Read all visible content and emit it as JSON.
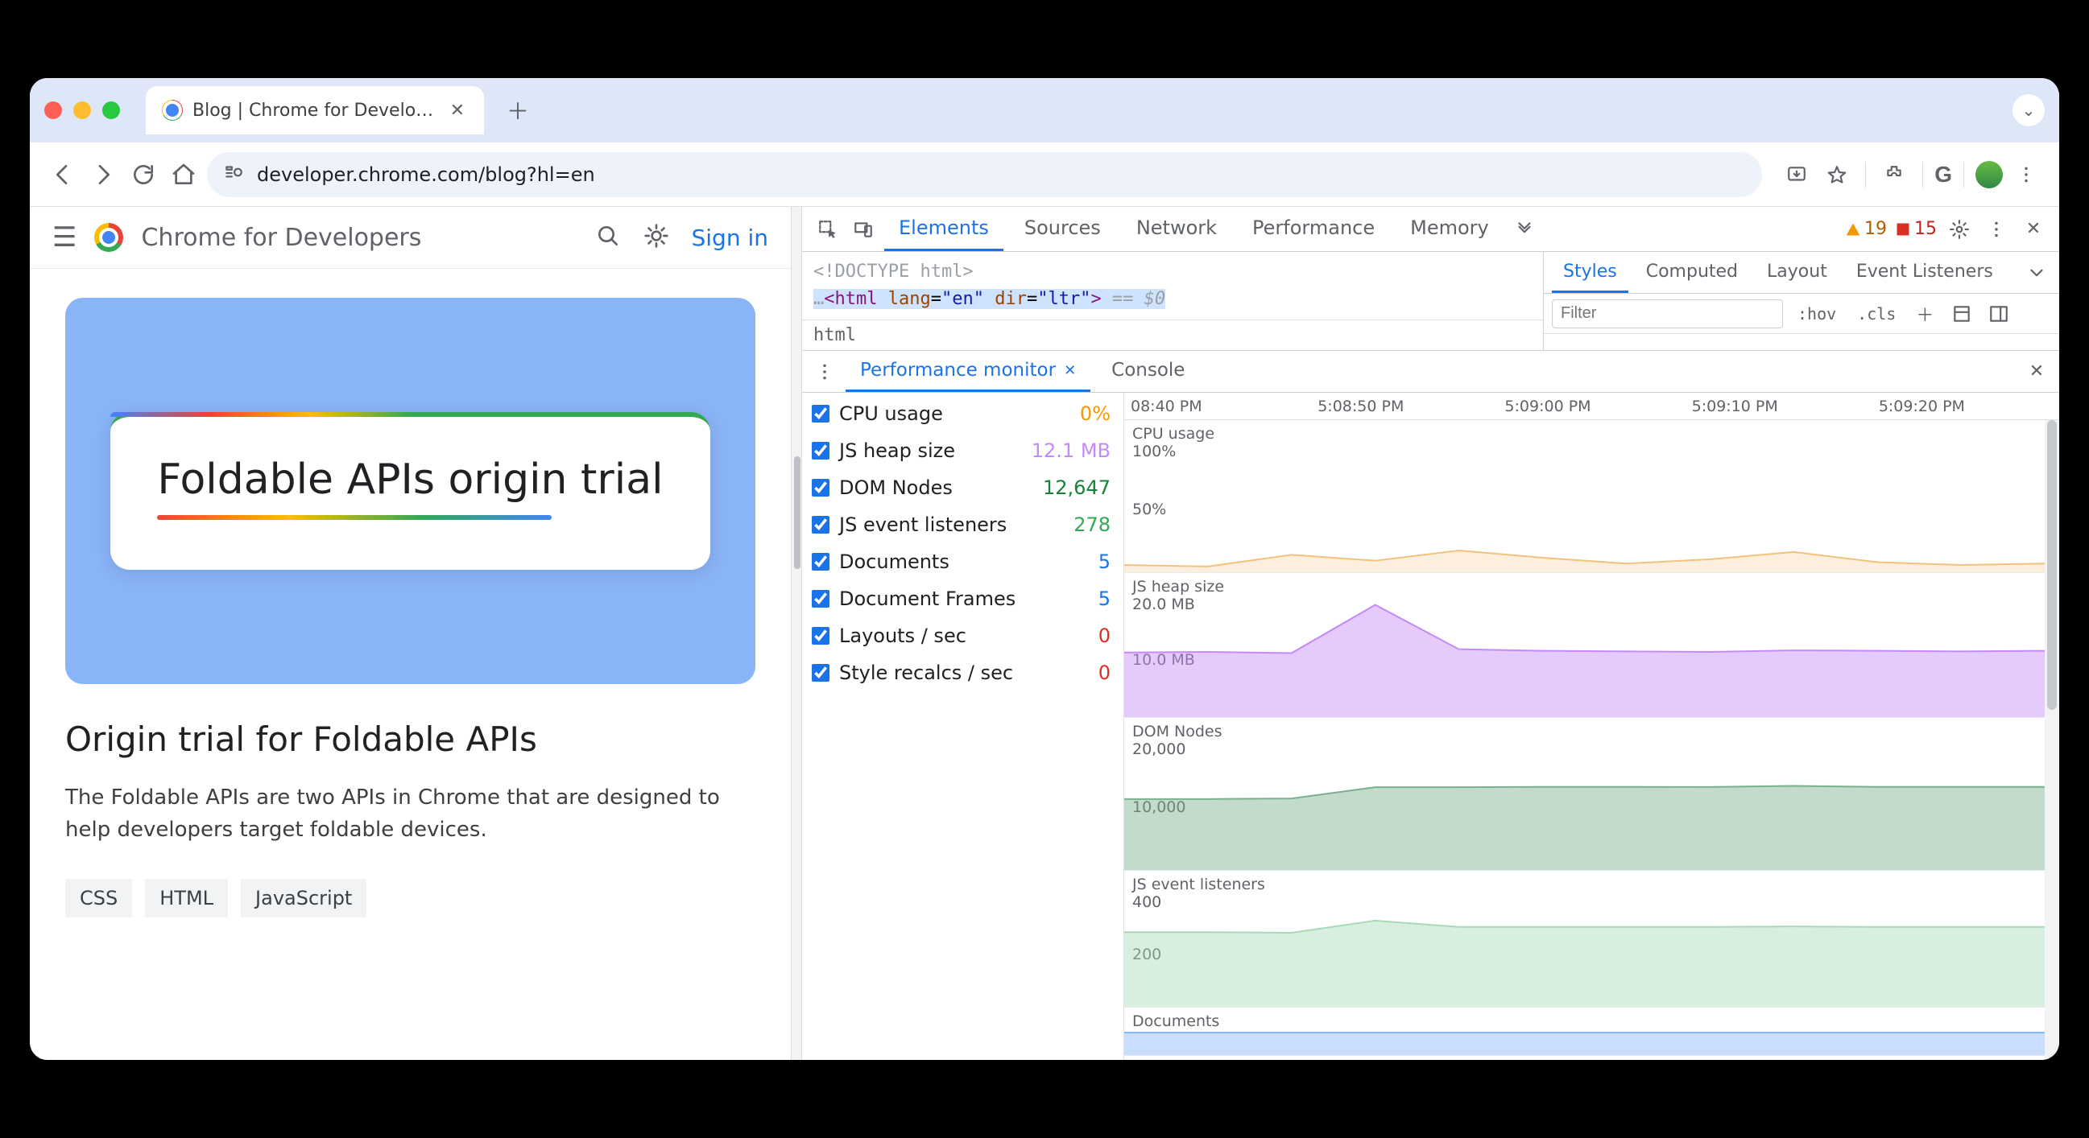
{
  "browser": {
    "tab_title": "Blog  |  Chrome for Developer",
    "url": "developer.chrome.com/blog?hl=en"
  },
  "page": {
    "site_title": "Chrome for Developers",
    "sign_in": "Sign in",
    "hero_title": "Foldable APIs origin trial",
    "article_title": "Origin trial for Foldable APIs",
    "article_body": "The Foldable APIs are two APIs in Chrome that are designed to help developers target foldable devices.",
    "tags": [
      "CSS",
      "HTML",
      "JavaScript"
    ]
  },
  "devtools": {
    "tabs": [
      "Elements",
      "Sources",
      "Network",
      "Performance",
      "Memory"
    ],
    "active_tab": "Elements",
    "warnings": 19,
    "errors": 15,
    "dom_line1": "<!DOCTYPE html>",
    "dom_line2_pre": "…",
    "dom_line2_open": "<html ",
    "dom_line2_attr1": "lang",
    "dom_line2_val1": "\"en\"",
    "dom_line2_attr2": "dir",
    "dom_line2_val2": "\"ltr\"",
    "dom_line2_close": ">",
    "dom_line2_suffix": " == $0",
    "breadcrumb": "html",
    "styles_tabs": [
      "Styles",
      "Computed",
      "Layout",
      "Event Listeners"
    ],
    "styles_active": "Styles",
    "filter_placeholder": "Filter",
    "hov": ":hov",
    "cls": ".cls"
  },
  "drawer": {
    "tabs": [
      "Performance monitor",
      "Console"
    ],
    "active": "Performance monitor",
    "metrics": [
      {
        "name": "CPU usage",
        "value": "0%",
        "color": "#f29900"
      },
      {
        "name": "JS heap size",
        "value": "12.1 MB",
        "color": "#c58af9"
      },
      {
        "name": "DOM Nodes",
        "value": "12,647",
        "color": "#188038"
      },
      {
        "name": "JS event listeners",
        "value": "278",
        "color": "#34a853"
      },
      {
        "name": "Documents",
        "value": "5",
        "color": "#1a73e8"
      },
      {
        "name": "Document Frames",
        "value": "5",
        "color": "#1a73e8"
      },
      {
        "name": "Layouts / sec",
        "value": "0",
        "color": "#d93025"
      },
      {
        "name": "Style recalcs / sec",
        "value": "0",
        "color": "#d93025"
      }
    ],
    "timeline": [
      "08:40 PM",
      "5:08:50 PM",
      "5:09:00 PM",
      "5:09:10 PM",
      "5:09:20 PM"
    ]
  },
  "chart_data": [
    {
      "type": "line",
      "title": "CPU usage",
      "ylabel": "",
      "ylim": [
        0,
        100
      ],
      "unit": "%",
      "ticks": [
        "100%",
        "50%"
      ],
      "x": [
        "08:40",
        "08:50",
        "09:00",
        "09:10",
        "09:20"
      ],
      "series": [
        {
          "name": "cpu",
          "color": "#f4c17d",
          "values": [
            5,
            4,
            12,
            8,
            15,
            10,
            6,
            9,
            14,
            7,
            5,
            6
          ]
        }
      ]
    },
    {
      "type": "area",
      "title": "JS heap size",
      "ylabel": "",
      "ylim": [
        0,
        25
      ],
      "unit": "MB",
      "ticks": [
        "20.0 MB",
        "10.0 MB"
      ],
      "x": [
        "08:40",
        "08:50",
        "09:00",
        "09:10",
        "09:20"
      ],
      "series": [
        {
          "name": "heap",
          "color": "#c58af9",
          "values": [
            11.8,
            11.9,
            11.7,
            20.5,
            12.4,
            12.1,
            12.0,
            11.9,
            12.2,
            12.1,
            12.0,
            12.1
          ]
        }
      ]
    },
    {
      "type": "area",
      "title": "DOM Nodes",
      "ylabel": "",
      "ylim": [
        0,
        22000
      ],
      "ticks": [
        "20,000",
        "10,000"
      ],
      "x": [
        "08:40",
        "08:50",
        "09:00",
        "09:10",
        "09:20"
      ],
      "series": [
        {
          "name": "nodes",
          "color": "#7bb08c",
          "values": [
            10800,
            10800,
            10900,
            12600,
            12600,
            12647,
            12647,
            12640,
            12800,
            12647,
            12647,
            12647
          ]
        }
      ]
    },
    {
      "type": "area",
      "title": "JS event listeners",
      "ylabel": "",
      "ylim": [
        0,
        450
      ],
      "ticks": [
        "400",
        "200"
      ],
      "x": [
        "08:40",
        "08:50",
        "09:00",
        "09:10",
        "09:20"
      ],
      "series": [
        {
          "name": "listeners",
          "color": "#a8dab5",
          "values": [
            260,
            260,
            258,
            300,
            278,
            278,
            278,
            278,
            280,
            278,
            278,
            278
          ]
        }
      ]
    },
    {
      "type": "area",
      "title": "Documents",
      "ylabel": "",
      "ylim": [
        0,
        10
      ],
      "ticks": [],
      "x": [
        "08:40",
        "08:50",
        "09:00",
        "09:10",
        "09:20"
      ],
      "series": [
        {
          "name": "docs",
          "color": "#8ab4f8",
          "values": [
            5,
            5,
            5,
            5,
            5,
            5,
            5,
            5,
            5,
            5,
            5,
            5
          ]
        }
      ]
    }
  ]
}
